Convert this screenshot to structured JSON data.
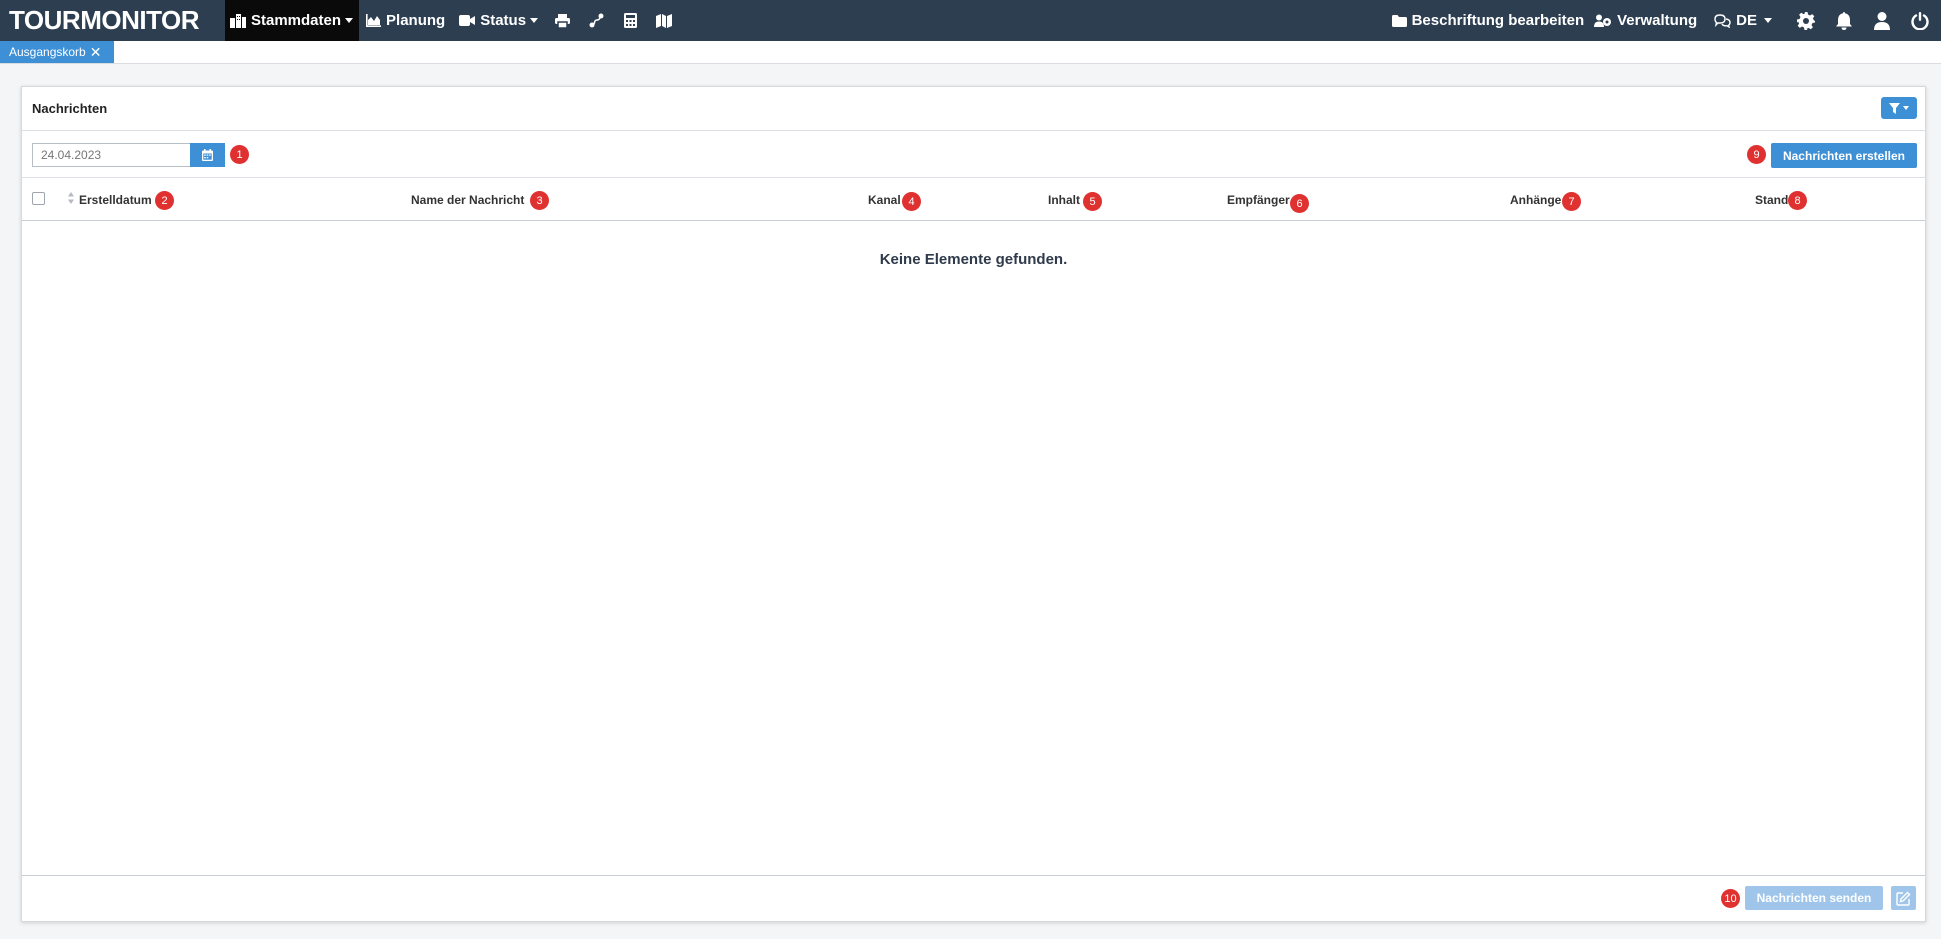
{
  "app": {
    "brand": "TOURMONITOR"
  },
  "nav": {
    "stammdaten": "Stammdaten",
    "planung": "Planung",
    "status": "Status",
    "icons": [
      "print-icon",
      "route-icon",
      "calculator-icon",
      "map-icon"
    ],
    "beschriftung": "Beschriftung bearbeiten",
    "verwaltung": "Verwaltung",
    "language": "DE",
    "right_icons": [
      "gear-icon",
      "bell-icon",
      "user-icon",
      "power-icon"
    ]
  },
  "tabs": [
    {
      "label": "Ausgangskorb",
      "close": "✕"
    }
  ],
  "panel": {
    "title": "Nachrichten",
    "date_value": "24.04.2023",
    "create_button": "Nachrichten erstellen",
    "columns": [
      "Erstelldatum",
      "Name der Nachricht",
      "Kanal",
      "Inhalt",
      "Empfänger",
      "Anhänge",
      "Stand"
    ],
    "empty_text": "Keine Elemente gefunden.",
    "send_button": "Nachrichten senden"
  },
  "badges": {
    "b1": "1",
    "b2": "2",
    "b3": "3",
    "b4": "4",
    "b5": "5",
    "b6": "6",
    "b7": "7",
    "b8": "8",
    "b9": "9",
    "b10": "10"
  },
  "colors": {
    "topbar": "#2c3e50",
    "accent": "#3d8fd6",
    "badge": "#e03131",
    "disabled": "#9fc6ea"
  }
}
